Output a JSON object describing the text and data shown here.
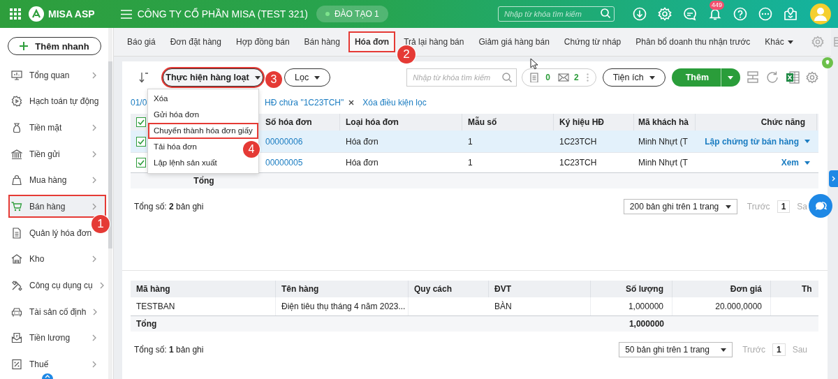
{
  "header": {
    "logo_text": "MISA ASP",
    "company": "CÔNG TY CỔ PHẦN MISA (TEST 321)",
    "workspace": "ĐÀO TẠO 1",
    "search": {
      "placeholder": "Nhập từ khóa tìm kiếm"
    },
    "notification_count": "449"
  },
  "sidebar": {
    "quick_add": "Thêm nhanh",
    "items": [
      {
        "label": "Tổng quan",
        "has_children": true,
        "selected": false
      },
      {
        "label": "Hạch toán tự động",
        "has_children": false,
        "selected": false
      },
      {
        "label": "Tiền mặt",
        "has_children": true,
        "selected": false
      },
      {
        "label": "Tiền gửi",
        "has_children": true,
        "selected": false
      },
      {
        "label": "Mua hàng",
        "has_children": true,
        "selected": false
      },
      {
        "label": "Bán hàng",
        "has_children": true,
        "selected": true,
        "callout": "1"
      },
      {
        "label": "Quản lý hóa đơn",
        "has_children": false,
        "selected": false
      },
      {
        "label": "Kho",
        "has_children": true,
        "selected": false
      },
      {
        "label": "Công cụ dụng cụ",
        "has_children": true,
        "selected": false
      },
      {
        "label": "Tài sản cố định",
        "has_children": true,
        "selected": false
      },
      {
        "label": "Tiền lương",
        "has_children": true,
        "selected": false
      },
      {
        "label": "Thuế",
        "has_children": true,
        "selected": false
      }
    ]
  },
  "tabs": [
    {
      "label": "Báo giá",
      "kind": "tab",
      "selected": false
    },
    {
      "label": "Đơn đặt hàng",
      "kind": "tab",
      "selected": false
    },
    {
      "label": "Hợp đồng bán",
      "kind": "tab",
      "selected": false
    },
    {
      "label": "Bán hàng",
      "kind": "tab",
      "selected": false
    },
    {
      "label": "Hóa đơn",
      "kind": "tab",
      "selected": true,
      "callout": "2"
    },
    {
      "label": "Trả lại hàng bán",
      "kind": "tab",
      "selected": false
    },
    {
      "label": "Giảm giá hàng bán",
      "kind": "tab",
      "selected": false
    },
    {
      "label": "Chứng từ nháp",
      "kind": "tab",
      "selected": false
    },
    {
      "label": "Phân bổ doanh thu nhận trước",
      "kind": "tab",
      "selected": false
    },
    {
      "label": "Khác",
      "kind": "menu",
      "selected": false
    }
  ],
  "toolbar": {
    "bulk_action": {
      "label": "Thực hiện hàng loạt",
      "expanded": true,
      "callout": "3"
    },
    "filter": "Lọc",
    "search": {
      "placeholder": "Nhập từ khóa tìm kiếm"
    },
    "counters": [
      "0",
      "2"
    ],
    "utilities": "Tiện ích",
    "add": "Thêm"
  },
  "bulk_menu": [
    {
      "label": "Xóa"
    },
    {
      "label": "Gửi hóa đơn"
    },
    {
      "label": "Chuyển thành hóa đơn giấy",
      "callout": "4"
    },
    {
      "label": "Tải hóa đơn"
    },
    {
      "label": "Lập lệnh sản xuất"
    }
  ],
  "filters": {
    "items": [
      {
        "text": "01/0",
        "removable": false
      },
      {
        "text": "HĐ chứa \"1C23TCH\"",
        "removable": true
      }
    ],
    "clear": "Xóa điều kiện lọc"
  },
  "invoices": {
    "all_checked": true,
    "columns": [
      "Số hóa đơn",
      "Loại hóa đơn",
      "Mẫu số",
      "Ký hiệu HĐ",
      "Mã khách hà",
      "Chức năng"
    ],
    "rows": [
      {
        "selected": true,
        "checked": true,
        "cells": [
          "00000006",
          "Hóa đơn",
          "1",
          "1C23TCH",
          "Minh Nhựt (T"
        ],
        "action": "Lập chứng từ bán hàng"
      },
      {
        "selected": false,
        "checked": true,
        "cells": [
          "00000005",
          "Hóa đơn",
          "1",
          "1C23TCH",
          "Minh Nhựt (T"
        ],
        "action": "Xem"
      }
    ],
    "total_label": "Tổng",
    "footer": {
      "total": "Tổng số: **2** bản ghi",
      "page_size": "200 bản ghi trên 1 trang",
      "prev": "Trước",
      "page": "1",
      "next": "Sa"
    }
  },
  "details": {
    "columns": [
      "Mã hàng",
      "Tên hàng",
      "Quy cách",
      "ĐVT",
      "Số lượng",
      "Đơn giá",
      "Th"
    ],
    "rows": [
      {
        "cells": [
          "TESTBAN",
          "Điện tiêu thụ tháng 4 năm 2023...",
          null,
          "BÀN",
          "1,000000",
          "20.000,0000",
          null
        ]
      }
    ],
    "totals": {
      "label": "Tổng",
      "quantity": "1,000000"
    },
    "footer": {
      "total": "Tổng số: **1** bản ghi",
      "page_size": "50 bản ghi trên 1 trang",
      "prev": "Trước",
      "page": "1",
      "next": "Sau"
    }
  }
}
